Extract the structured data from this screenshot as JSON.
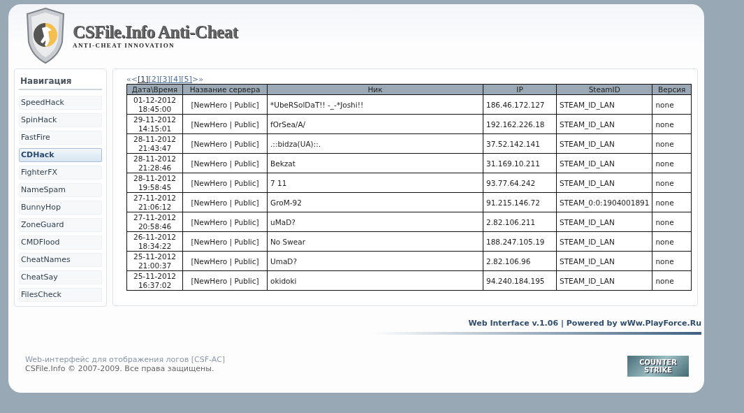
{
  "logo": {
    "title": "CSFile.Info Anti-Cheat",
    "tagline": "ANTI-CHEAT INNOVATION"
  },
  "sidebar": {
    "title": "Навигация",
    "items": [
      {
        "label": "SpeedHack",
        "selected": false
      },
      {
        "label": "SpinHack",
        "selected": false
      },
      {
        "label": "FastFire",
        "selected": false
      },
      {
        "label": "CDHack",
        "selected": true
      },
      {
        "label": "FighterFX",
        "selected": false
      },
      {
        "label": "NameSpam",
        "selected": false
      },
      {
        "label": "BunnyHop",
        "selected": false
      },
      {
        "label": "ZoneGuard",
        "selected": false
      },
      {
        "label": "CMDFlood",
        "selected": false
      },
      {
        "label": "CheatNames",
        "selected": false
      },
      {
        "label": "CheatSay",
        "selected": false
      },
      {
        "label": "FilesCheck",
        "selected": false
      }
    ]
  },
  "pagination": {
    "first": "«",
    "prev": "<",
    "pages": [
      {
        "label": "[1]",
        "selected": true
      },
      {
        "label": "[2]",
        "selected": false
      },
      {
        "label": "[3]",
        "selected": false
      },
      {
        "label": "[4]",
        "selected": false
      },
      {
        "label": "[5]",
        "selected": false
      }
    ],
    "next": ">",
    "last": "»"
  },
  "table": {
    "columns": [
      "Дата\\Время",
      "Название сервера",
      "Ник",
      "IP",
      "SteamID",
      "Версия"
    ],
    "rows": [
      {
        "date": "01-12-2012",
        "time": "18:45:00",
        "server": "[NewHero | Public]",
        "nick": "*UbeRSolDaT!! -_-*Joshi!!",
        "ip": "186.46.172.127",
        "steamid": "STEAM_ID_LAN",
        "version": "none"
      },
      {
        "date": "29-11-2012",
        "time": "14:15:01",
        "server": "[NewHero | Public]",
        "nick": "fOrSea/A/",
        "ip": "192.162.226.18",
        "steamid": "STEAM_ID_LAN",
        "version": "none"
      },
      {
        "date": "28-11-2012",
        "time": "21:43:47",
        "server": "[NewHero | Public]",
        "nick": ".::bidza(UA)::.",
        "ip": "37.52.142.141",
        "steamid": "STEAM_ID_LAN",
        "version": "none"
      },
      {
        "date": "28-11-2012",
        "time": "21:28:46",
        "server": "[NewHero | Public]",
        "nick": "Bekzat",
        "ip": "31.169.10.211",
        "steamid": "STEAM_ID_LAN",
        "version": "none"
      },
      {
        "date": "28-11-2012",
        "time": "19:58:45",
        "server": "[NewHero | Public]",
        "nick": "7 11",
        "ip": "93.77.64.242",
        "steamid": "STEAM_ID_LAN",
        "version": "none"
      },
      {
        "date": "27-11-2012",
        "time": "21:06:12",
        "server": "[NewHero | Public]",
        "nick": "GroM-92",
        "ip": "91.215.146.72",
        "steamid": "STEAM_0:0:1904001891",
        "version": "none"
      },
      {
        "date": "27-11-2012",
        "time": "20:58:46",
        "server": "[NewHero | Public]",
        "nick": "uMaD?",
        "ip": "2.82.106.211",
        "steamid": "STEAM_ID_LAN",
        "version": "none"
      },
      {
        "date": "26-11-2012",
        "time": "18:34:22",
        "server": "[NewHero | Public]",
        "nick": "No Swear",
        "ip": "188.247.105.19",
        "steamid": "STEAM_ID_LAN",
        "version": "none"
      },
      {
        "date": "25-11-2012",
        "time": "21:00:37",
        "server": "[NewHero | Public]",
        "nick": "UmaD?",
        "ip": "2.82.106.96",
        "steamid": "STEAM_ID_LAN",
        "version": "none"
      },
      {
        "date": "25-11-2012",
        "time": "16:37:02",
        "server": "[NewHero | Public]",
        "nick": "okidoki",
        "ip": "94.240.184.195",
        "steamid": "STEAM_ID_LAN",
        "version": "none"
      }
    ]
  },
  "powered_by": "Web Interface v.1.06 | Powered by wWw.PlayForce.Ru",
  "footer": {
    "lines": [
      "Web-интерфейс для отображения логов [CSF-AC]",
      "CSFile.Info © 2007-2009. Все права защищены."
    ],
    "badge": [
      "COUNTER",
      "STRIKE"
    ]
  }
}
